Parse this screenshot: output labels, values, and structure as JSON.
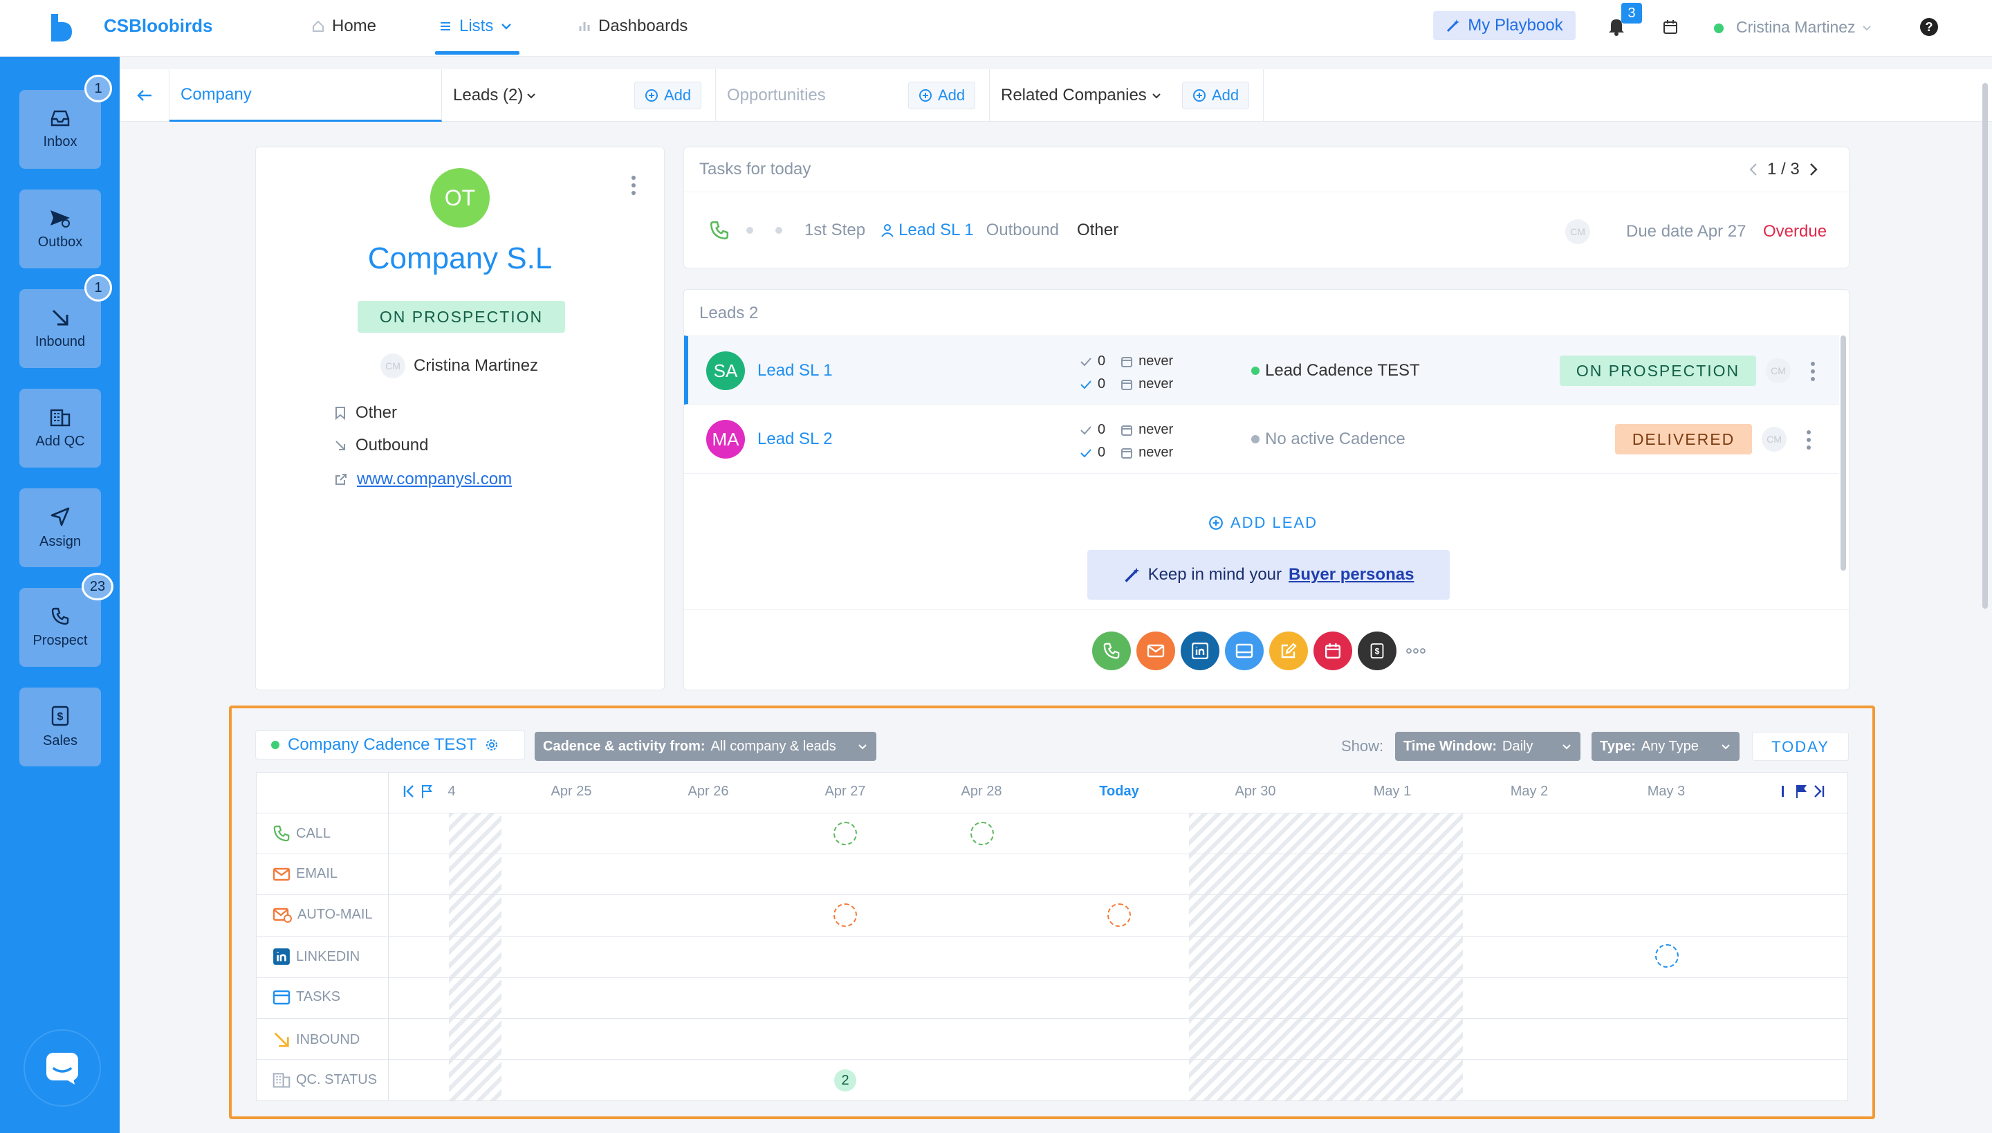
{
  "app": {
    "name": "CSBloobirds"
  },
  "nav": {
    "home": "Home",
    "lists": "Lists",
    "dashboards": "Dashboards"
  },
  "header": {
    "playbook": "My Playbook",
    "notifications": "3",
    "user": "Cristina Martinez"
  },
  "sidebar": {
    "items": [
      {
        "label": "Inbox",
        "badge": "1"
      },
      {
        "label": "Outbox",
        "badge": ""
      },
      {
        "label": "Inbound",
        "badge": "1"
      },
      {
        "label": "Add QC",
        "badge": ""
      },
      {
        "label": "Assign",
        "badge": ""
      },
      {
        "label": "Prospect",
        "badge": "23"
      },
      {
        "label": "Sales",
        "badge": ""
      }
    ]
  },
  "tabs": {
    "company": "Company",
    "leads": "Leads (2)",
    "opportunities": "Opportunities",
    "related": "Related Companies",
    "add": "Add"
  },
  "company": {
    "initials": "OT",
    "name": "Company S.L",
    "status": "ON PROSPECTION",
    "owner_initials": "CM",
    "owner": "Cristina Martinez",
    "source": "Other",
    "type": "Outbound",
    "website": "www.companysl.com"
  },
  "tasks": {
    "title": "Tasks for today",
    "pager": "1 / 3",
    "step": "1st Step",
    "lead": "Lead SL 1",
    "type": "Outbound",
    "source": "Other",
    "assignee_initials": "CM",
    "due": "Due date Apr 27",
    "overdue": "Overdue"
  },
  "leads": {
    "title": "Leads 2",
    "items": [
      {
        "initials": "SA",
        "name": "Lead SL 1",
        "count1": "0",
        "date1": "never",
        "count2": "0",
        "date2": "never",
        "cadence": "Lead Cadence TEST",
        "status": "ON PROSPECTION",
        "owner_initials": "CM"
      },
      {
        "initials": "MA",
        "name": "Lead SL 2",
        "count1": "0",
        "date1": "never",
        "count2": "0",
        "date2": "never",
        "cadence": "No active Cadence",
        "status": "DELIVERED",
        "owner_initials": "CM"
      }
    ],
    "add_lead": "ADD LEAD",
    "tip_prefix": "Keep in mind your",
    "tip_link": "Buyer personas"
  },
  "actions": [
    "phone-icon",
    "mail-icon",
    "linkedin-icon",
    "meeting-icon",
    "note-icon",
    "calendar-icon",
    "dollar-icon",
    "more-icon"
  ],
  "cadence": {
    "name": "Company Cadence TEST",
    "filter_label": "Cadence & activity from:",
    "filter_value": "All company & leads",
    "show": "Show:",
    "window_label": "Time Window:",
    "window_value": "Daily",
    "type_label": "Type:",
    "type_value": "Any Type",
    "today": "TODAY",
    "dates": [
      "4",
      "Apr 25",
      "Apr 26",
      "Apr 27",
      "Apr 28",
      "Today",
      "Apr 30",
      "May 1",
      "May 2",
      "May 3"
    ],
    "rows": [
      "CALL",
      "EMAIL",
      "AUTO-MAIL",
      "LINKEDIN",
      "TASKS",
      "INBOUND",
      "QC. STATUS"
    ],
    "qc_count": "2"
  },
  "colors": {
    "brand": "#1f8ff2",
    "orange": "#f39a35",
    "green": "#5cb85c",
    "red": "#e0294b"
  }
}
